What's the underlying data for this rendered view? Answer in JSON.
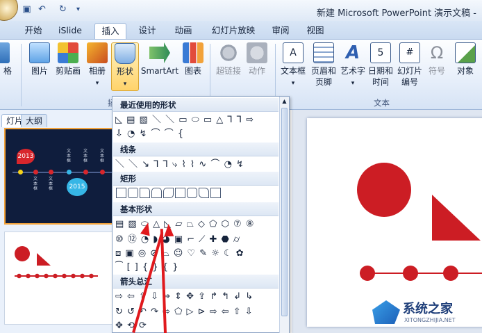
{
  "window": {
    "title": "新建 Microsoft PowerPoint 演示文稿 -"
  },
  "qat": {
    "save_icon": "save-icon",
    "undo_icon": "undo-icon",
    "redo_icon": "redo-icon",
    "more": "▾"
  },
  "tabs": [
    {
      "label": "开始"
    },
    {
      "label": "iSlide"
    },
    {
      "label": "插入",
      "active": true
    },
    {
      "label": "设计"
    },
    {
      "label": "动画"
    },
    {
      "label": "幻灯片放映"
    },
    {
      "label": "审阅"
    },
    {
      "label": "视图"
    }
  ],
  "ribbon": {
    "left_cut_label": "格",
    "buttons": [
      {
        "label": "图片"
      },
      {
        "label": "剪贴画"
      },
      {
        "label": "相册"
      },
      {
        "label": "形状"
      },
      {
        "label": "SmartArt"
      },
      {
        "label": "图表"
      },
      {
        "label": "超链接"
      },
      {
        "label": "动作"
      },
      {
        "label": "文本框"
      },
      {
        "label": "页眉和\n页脚"
      },
      {
        "label": "艺术字"
      },
      {
        "label": "日期和\n时间"
      },
      {
        "label": "幻灯片\n编号"
      },
      {
        "label": "符号"
      },
      {
        "label": "对象"
      }
    ],
    "group_text": "文本",
    "group_left_cut": "插"
  },
  "pane": {
    "tab_slides": "灯片",
    "tab_outline": "大纲"
  },
  "slide1": {
    "year1": "2013",
    "year2": "2015",
    "node_label": "文本框"
  },
  "gallery": {
    "sections": [
      {
        "title": "最近使用的形状"
      },
      {
        "title": "线条"
      },
      {
        "title": "矩形"
      },
      {
        "title": "基本形状"
      },
      {
        "title": "箭头总汇"
      }
    ]
  },
  "watermark": {
    "brand": "系统之家",
    "url": "XITONGZHIJIA.NET"
  },
  "colors": {
    "accent_red": "#cc1d24",
    "ribbon_blue": "#c9daf0",
    "hot": "#ffd36b"
  }
}
